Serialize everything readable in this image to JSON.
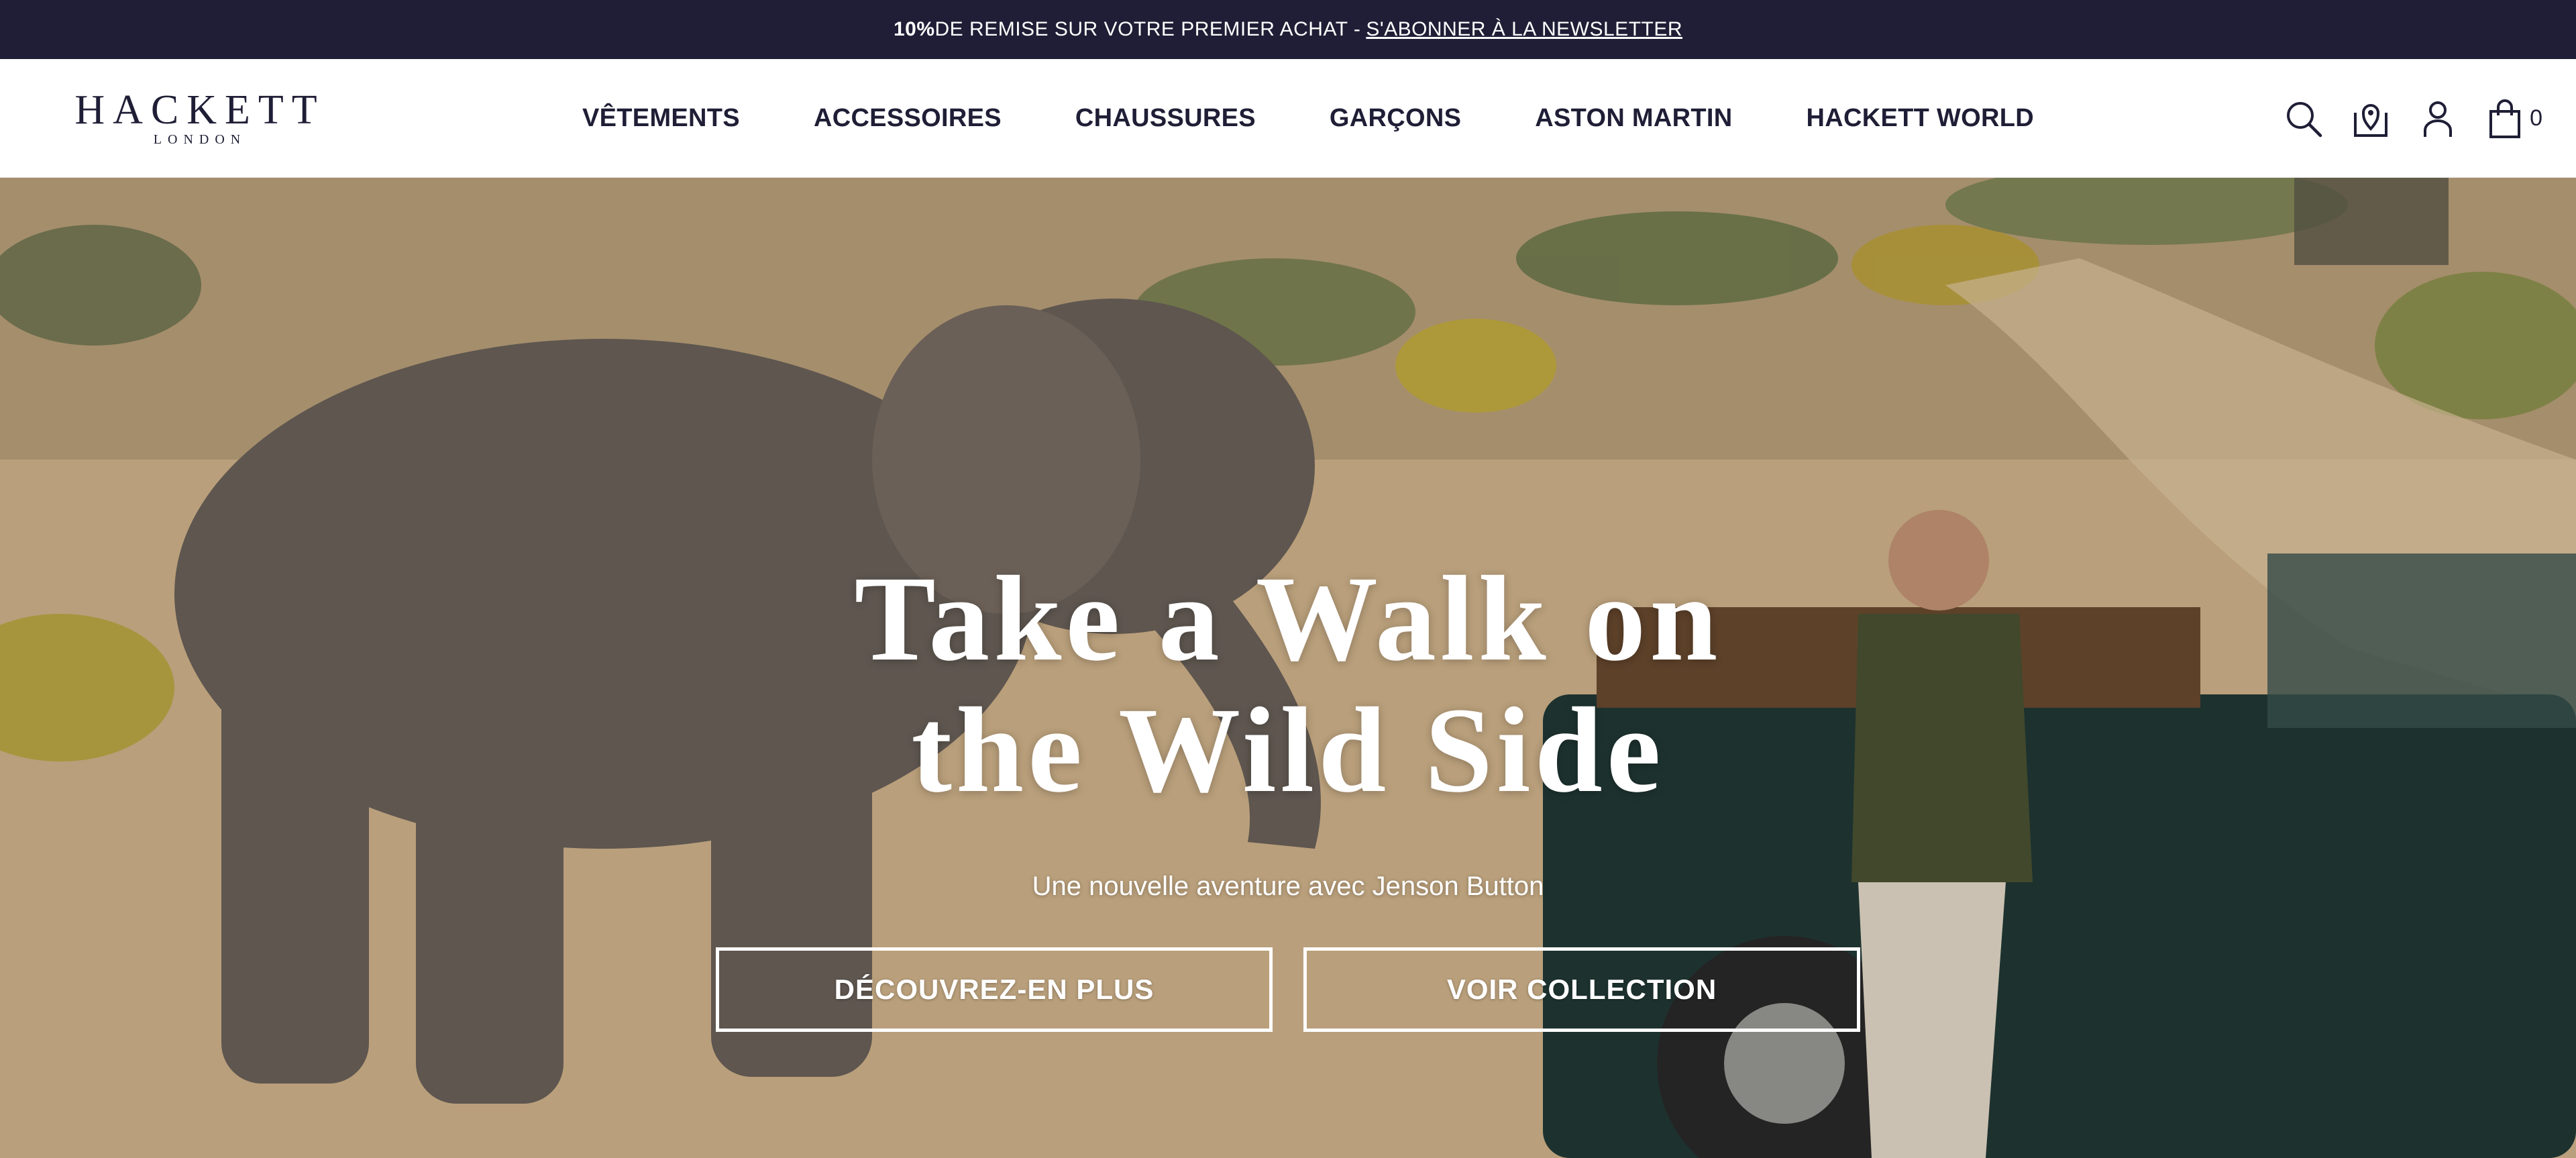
{
  "promo": {
    "bold": "10%",
    "text": " DE REMISE SUR VOTRE PREMIER ACHAT - ",
    "link": "S'ABONNER À LA NEWSLETTER"
  },
  "header": {
    "logo_brand": "HACKETT",
    "logo_city": "LONDON",
    "nav": [
      "VÊTEMENTS",
      "ACCESSOIRES",
      "CHAUSSURES",
      "GARÇONS",
      "ASTON MARTIN",
      "HACKETT WORLD"
    ],
    "icons": [
      "search-icon",
      "store-locator-icon",
      "account-icon",
      "cart-icon"
    ],
    "cart_count": "0"
  },
  "hero": {
    "title_line1": "Take a Walk on",
    "title_line2": "the Wild Side",
    "subtitle": "Une nouvelle aventure avec Jenson Button",
    "button_primary": "DÉCOUVREZ-EN PLUS",
    "button_secondary": "VOIR COLLECTION"
  },
  "colors": {
    "promo_bg": "#1f1e36",
    "text_dark": "#1f1e36",
    "hero_sand": "#d9bc94"
  }
}
